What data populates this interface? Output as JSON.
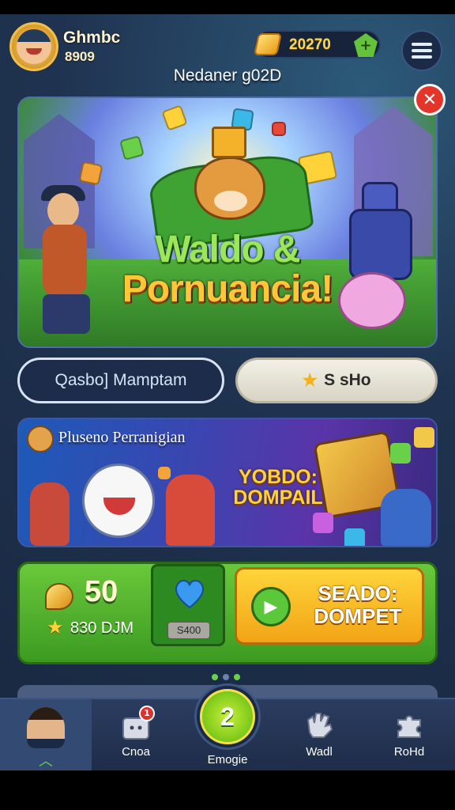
{
  "header": {
    "player_name": "Ghmbc",
    "player_level": "8909",
    "coins": "20270",
    "event_title": "Nedaner g02D"
  },
  "hero": {
    "title_line1": "Waldo &",
    "title_line2": "Pornuancia!"
  },
  "tabs": {
    "left_label": "Qasbo] Mamptam",
    "right_label": "S sHo"
  },
  "promo": {
    "title": "Pluseno Perranigian",
    "logo_line1": "YOBDO:",
    "logo_line2": "DOMPAIL"
  },
  "reward": {
    "amount": "50",
    "sub_label": "830 DJM",
    "heart_label": "S400",
    "cta_line1": "SEADO:",
    "cta_line2": "DOMPET"
  },
  "navbar": {
    "items": [
      {
        "label": ""
      },
      {
        "label": "Cnoa",
        "badge": "1"
      },
      {
        "label": "Emogie",
        "number": "2"
      },
      {
        "label": "Wadl"
      },
      {
        "label": "RoHd"
      }
    ]
  },
  "colors": {
    "accent_green": "#6ac83a",
    "accent_gold": "#ffd43a",
    "close_red": "#e4352a",
    "background": "#1f3350"
  },
  "icons": [
    "avatar",
    "coin-icon",
    "gem-plus-icon",
    "menu-icon",
    "close-icon",
    "star-icon",
    "bean-coin-icon",
    "heart-icon",
    "play-icon",
    "chevron-up-icon",
    "gift-icon",
    "hand-icon",
    "puzzle-icon"
  ]
}
